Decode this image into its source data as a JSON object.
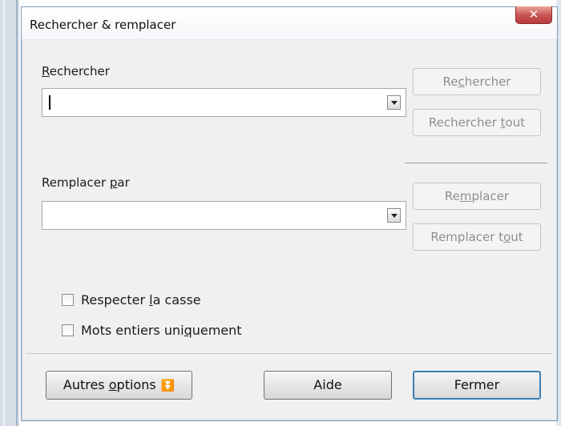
{
  "window": {
    "title": "Rechercher & remplacer",
    "close_glyph": "✕"
  },
  "search": {
    "label_pre": "",
    "label_key": "R",
    "label_post": "echercher",
    "value": ""
  },
  "replace": {
    "label_pre": "Remplacer ",
    "label_key": "p",
    "label_post": "ar",
    "value": ""
  },
  "buttons": {
    "find": {
      "pre": "Re",
      "key": "c",
      "post": "hercher",
      "enabled": false
    },
    "find_all": {
      "pre": "Rechercher ",
      "key": "t",
      "post": "out",
      "enabled": false
    },
    "replace": {
      "pre": "Re",
      "key": "m",
      "post": "placer",
      "enabled": false
    },
    "replace_all": {
      "pre": "Remplacer t",
      "key": "o",
      "post": "ut",
      "enabled": false
    },
    "more_options": {
      "pre": "Autres ",
      "key": "o",
      "post": "ptions",
      "icon": "double-chevron-down-icon",
      "glyph": "⏬"
    },
    "help": {
      "label": "Aide"
    },
    "close": {
      "label": "Fermer"
    }
  },
  "options": {
    "match_case": {
      "pre": "Respecter ",
      "key": "l",
      "post": "a casse",
      "checked": false
    },
    "whole_words": {
      "pre": "Mots entiers uni",
      "key": "q",
      "post": "uement",
      "checked": false
    }
  },
  "colors": {
    "close_button": "#c75050",
    "disabled_text": "#8e8e8e",
    "dialog_bg": "#f0f0f0"
  }
}
